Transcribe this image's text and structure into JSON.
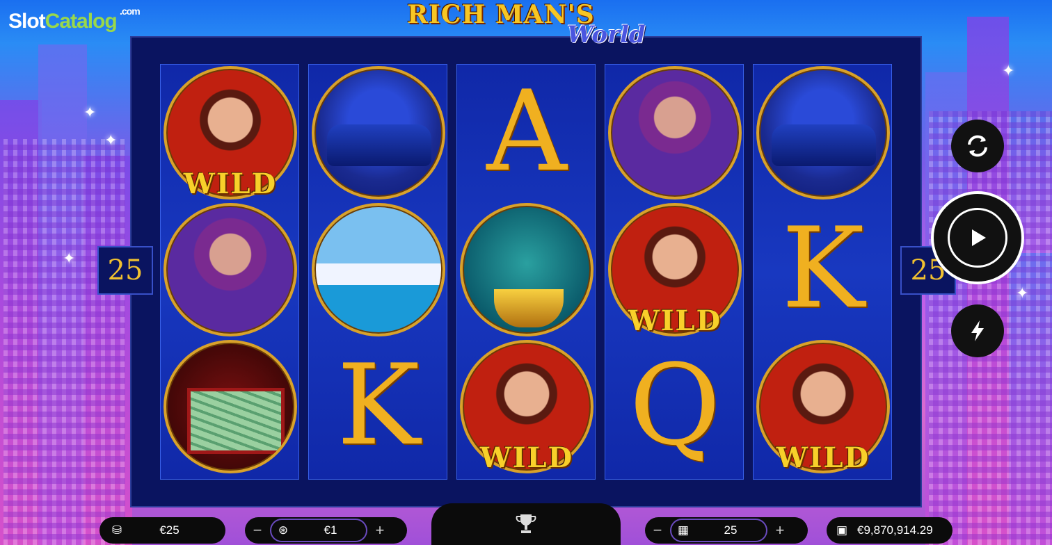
{
  "site_logo": {
    "part1": "Slot",
    "part2": "Catalog",
    "suffix": ".com"
  },
  "game_title": {
    "line1": "RICH MAN'S",
    "line2": "World"
  },
  "paylines": {
    "left": "25",
    "right": "25"
  },
  "reels": [
    [
      {
        "type": "man",
        "wild": "WILD"
      },
      {
        "type": "woman"
      },
      {
        "type": "case"
      }
    ],
    [
      {
        "type": "car"
      },
      {
        "type": "yacht"
      },
      {
        "type": "letter",
        "letter": "K"
      }
    ],
    [
      {
        "type": "letter",
        "letter": "A"
      },
      {
        "type": "champ"
      },
      {
        "type": "man",
        "wild": "WILD"
      }
    ],
    [
      {
        "type": "woman"
      },
      {
        "type": "man",
        "wild": "WILD"
      },
      {
        "type": "letter",
        "letter": "Q"
      }
    ],
    [
      {
        "type": "car"
      },
      {
        "type": "letter",
        "letter": "K"
      },
      {
        "type": "man",
        "wild": "WILD"
      }
    ]
  ],
  "controls": {
    "autoplay": "autoplay-icon",
    "spin": "play-icon",
    "turbo": "lightning-icon"
  },
  "bottom": {
    "total_bet": "€25",
    "coin_value": "€1",
    "lines": "25",
    "balance": "€9,870,914.29",
    "minus": "−",
    "plus": "+"
  }
}
